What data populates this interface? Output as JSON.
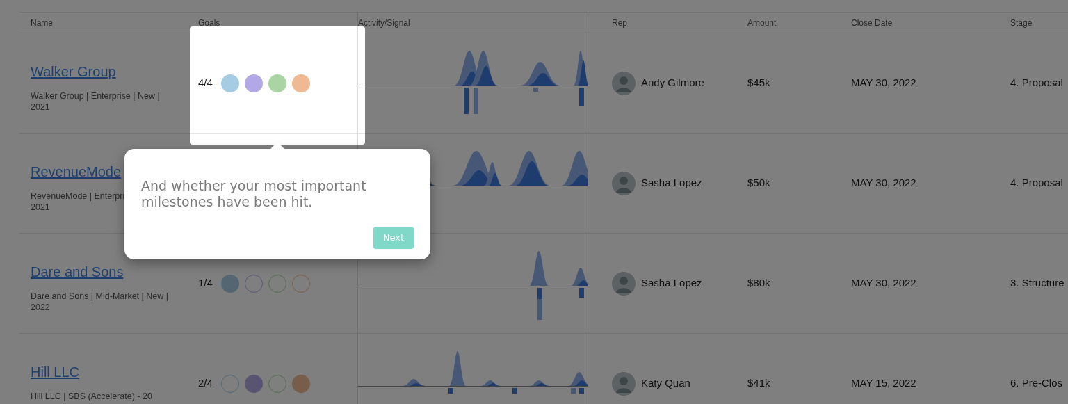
{
  "columns": [
    "Name",
    "Goals",
    "Activity/Signal",
    "Rep",
    "Amount",
    "Close Date",
    "Stage"
  ],
  "rows": [
    {
      "name": "Walker Group",
      "details_lines": [
        "Walker Group | Enterprise | New |",
        "2021"
      ],
      "goals": {
        "count": "4/4",
        "items": [
          {
            "color": "#a6cce4",
            "achieved": true
          },
          {
            "color": "#b3a8e6",
            "achieved": true
          },
          {
            "color": "#a8d5a2",
            "achieved": true
          },
          {
            "color": "#efb993",
            "achieved": true
          }
        ]
      },
      "rep": "Andy Gilmore",
      "amount": "$45k",
      "close_date": "MAY 30, 2022",
      "stage": "4. Proposal"
    },
    {
      "name": "RevenueMode",
      "details_lines": [
        "RevenueMode | Enterpri",
        "2021"
      ],
      "rep": "Sasha Lopez",
      "amount": "$50k",
      "close_date": "MAY 30, 2022",
      "stage": "4. Proposal"
    },
    {
      "name": "Dare and Sons",
      "details_lines": [
        "Dare and Sons | Mid-Market | New |",
        "2022"
      ],
      "goals": {
        "count": "1/4",
        "items": [
          {
            "color": "#536672",
            "achieved": true
          },
          {
            "color": "#5a5473",
            "achieved": false
          },
          {
            "color": "#546b51",
            "achieved": false
          },
          {
            "color": "#785d4a",
            "achieved": false
          }
        ]
      },
      "rep": "Sasha Lopez",
      "amount": "$80k",
      "close_date": "MAY 30, 2022",
      "stage": "3. Structure"
    },
    {
      "name": "Hill LLC",
      "details_lines": [
        "Hill LLC | SBS (Accelerate) - 20"
      ],
      "goals": {
        "count": "2/4",
        "items": [
          {
            "color": "#536672",
            "achieved": false
          },
          {
            "color": "#5a5473",
            "achieved": true
          },
          {
            "color": "#546b51",
            "achieved": false
          },
          {
            "color": "#785d4a",
            "achieved": true
          }
        ]
      },
      "rep": "Katy Quan",
      "amount": "$41k",
      "close_date": "MAY 15, 2022",
      "stage": "6. Pre-Clos"
    }
  ],
  "tour_tooltip": {
    "text": "And whether your most important milestones have been hit.",
    "button": "Next"
  }
}
